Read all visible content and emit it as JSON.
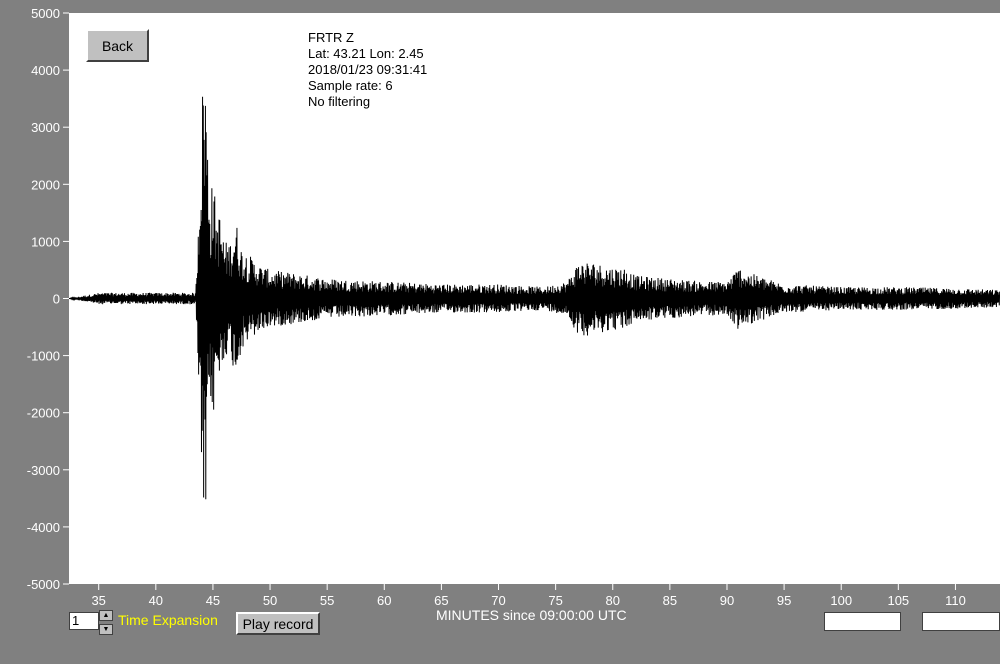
{
  "controls": {
    "back_label": "Back",
    "play_label": "Play record",
    "time_expansion_value": "1",
    "time_expansion_label": "Time Expansion",
    "box1_value": "",
    "box2_value": "",
    "spin_up_icon": "triangle-up",
    "spin_down_icon": "triangle-down"
  },
  "info": {
    "station": "FRTR  Z",
    "location": "Lat: 43.21 Lon: 2.45",
    "datetime": "2018/01/23 09:31:41",
    "sample_rate": "Sample rate: 6",
    "filter": "No filtering"
  },
  "colors": {
    "background": "#808080",
    "plot_background": "#ffffff",
    "trace": "#000000",
    "axis_text": "#ffffff",
    "expansion_label": "#ffff00"
  },
  "chart_data": {
    "type": "line",
    "title": "",
    "xlabel": "MINUTES since 09:00:00 UTC",
    "ylabel": "",
    "xlim": [
      32.4,
      113.9
    ],
    "ylim": [
      -5000,
      5000
    ],
    "x_ticks": [
      35,
      40,
      45,
      50,
      55,
      60,
      65,
      70,
      75,
      80,
      85,
      90,
      95,
      100,
      105,
      110
    ],
    "y_ticks": [
      5000,
      4000,
      3000,
      2000,
      1000,
      0,
      -1000,
      -2000,
      -3000,
      -4000,
      -5000
    ],
    "grid": false,
    "series": [
      {
        "x": [
          32.4,
          35,
          38,
          41,
          43.5,
          43.9,
          44.0,
          44.1,
          44.2,
          44.3,
          44.4,
          44.5,
          44.6,
          44.8,
          45.0,
          45.3,
          45.6,
          46.0,
          46.5,
          47.0,
          47.5,
          48.0,
          49.0,
          50.0,
          52.0,
          55.0,
          60.0,
          65.0,
          70.0,
          74.0,
          76.0,
          77.0,
          78.0,
          79.0,
          80.0,
          81.0,
          82.0,
          85.0,
          88.0,
          90.0,
          91.0,
          92.0,
          95.0,
          100.0,
          105.0,
          110.0,
          113.9
        ],
        "y": [
          0,
          100,
          -100,
          100,
          -100,
          2700,
          -3000,
          3800,
          -4500,
          4500,
          -3800,
          3000,
          -2500,
          1800,
          -2200,
          1500,
          -1500,
          1000,
          -1000,
          1400,
          -900,
          800,
          -600,
          500,
          -450,
          350,
          -300,
          250,
          -250,
          200,
          -300,
          650,
          -650,
          600,
          -550,
          550,
          -400,
          350,
          -300,
          300,
          -550,
          450,
          -250,
          200,
          -200,
          180,
          -150
        ]
      }
    ]
  }
}
